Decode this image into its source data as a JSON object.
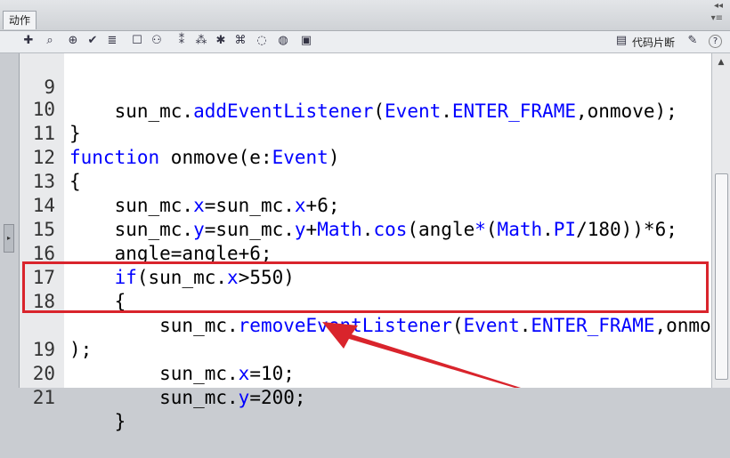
{
  "panel": {
    "tab_label": "动作",
    "collapse_glyph": "◂◂",
    "menu_glyph": "▾≡"
  },
  "toolbar": {
    "snippets_label": "代码片断",
    "help_glyph": "?"
  },
  "scrollbar": {
    "up_glyph": "▲"
  },
  "colors": {
    "accent_red": "#d9242c",
    "keyword_blue": "#0000ff"
  },
  "code_lines": [
    {
      "num": "9",
      "text": "    sun_mc.addEventListener(Event.ENTER_FRAME,onmove);"
    },
    {
      "num": "10",
      "text": "}"
    },
    {
      "num": "11",
      "text": "function onmove(e:Event)"
    },
    {
      "num": "12",
      "text": "{"
    },
    {
      "num": "13",
      "text": "    sun_mc.x=sun_mc.x+6;"
    },
    {
      "num": "14",
      "text": "    sun_mc.y=sun_mc.y+Math.cos(angle*(Math.PI/180))*6;"
    },
    {
      "num": "15",
      "text": "    angle=angle+6;"
    },
    {
      "num": "16",
      "text": "    if(sun_mc.x>550)"
    },
    {
      "num": "17",
      "text": "    {"
    },
    {
      "num": "18",
      "text": "        sun_mc.removeEventListener(Event.ENTER_FRAME,onmove"
    },
    {
      "num": "",
      "text": ");"
    },
    {
      "num": "19",
      "text": "        sun_mc.x=10;"
    },
    {
      "num": "20",
      "text": "        sun_mc.y=200;"
    },
    {
      "num": "21",
      "text": "    }"
    }
  ]
}
